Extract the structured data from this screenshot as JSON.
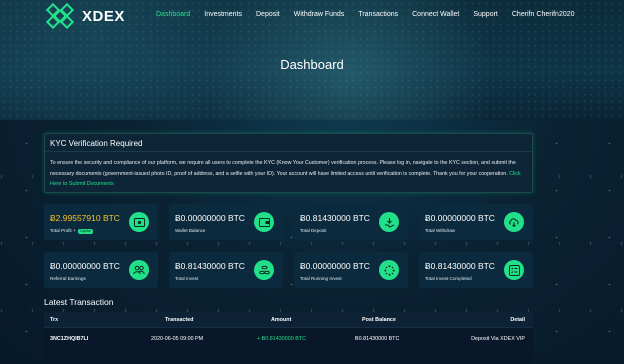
{
  "brand": {
    "name": "XDEX"
  },
  "nav": {
    "items": [
      {
        "label": "Dashboard",
        "active": true
      },
      {
        "label": "Investments",
        "active": false
      },
      {
        "label": "Deposit",
        "active": false
      },
      {
        "label": "Withdraw Funds",
        "active": false
      },
      {
        "label": "Transactions",
        "active": false
      },
      {
        "label": "Connect Wallet",
        "active": false
      },
      {
        "label": "Support",
        "active": false
      },
      {
        "label": "Cherifn Cherifn2020",
        "active": false
      }
    ]
  },
  "page": {
    "title": "Dashboard"
  },
  "kyc": {
    "title": "KYC Verification Required",
    "body": "To ensure the security and compliance of our platform, we require all users to complete the KYC (Know Your Customer) verification process. Please log in, navigate to the KYC section, and submit the necessary documents (government-issued photo ID, proof of address, and a selfie with your ID). Your account will have limited access until verification is complete. Thank you for your cooperation.",
    "link": "Click Here to Submit Documents"
  },
  "cards": [
    {
      "value": "Ƀ2.99557910 BTC",
      "label": "Total Profit +",
      "badge": "Capital",
      "icon": "money-icon",
      "gold": true
    },
    {
      "value": "Ƀ0.00000000 BTC",
      "label": "Wallet Balance",
      "icon": "wallet-icon"
    },
    {
      "value": "Ƀ0.81430000 BTC",
      "label": "Total Deposit",
      "icon": "deposit-icon"
    },
    {
      "value": "Ƀ0.00000000 BTC",
      "label": "Total Withdraw",
      "icon": "cloud-download-icon"
    },
    {
      "value": "Ƀ0.00000000 BTC",
      "label": "Referral Earnings",
      "icon": "users-icon"
    },
    {
      "value": "Ƀ0.81430000 BTC",
      "label": "Total Invest",
      "icon": "coins-icon"
    },
    {
      "value": "Ƀ0.00000000 BTC",
      "label": "Total Running Invest",
      "icon": "spinner-icon"
    },
    {
      "value": "Ƀ0.81430000 BTC",
      "label": "Total Invest Completed",
      "icon": "list-check-icon"
    }
  ],
  "transactions": {
    "title": "Latest Transaction",
    "columns": [
      "Trx",
      "Transacted",
      "Amount",
      "Post Balance",
      "Detail"
    ],
    "rows": [
      {
        "trx": "3NC1ZHQIB7LI",
        "transacted": "2020-06-05 09:00 PM",
        "amount": "+ Ƀ0.81430000 BTC",
        "post_balance": "Ƀ0.81430000 BTC",
        "detail": "Deposit Via XDEX VIP"
      }
    ]
  },
  "colors": {
    "accent": "#22e08a",
    "gold": "#f5c227",
    "background": "#0a2233"
  }
}
